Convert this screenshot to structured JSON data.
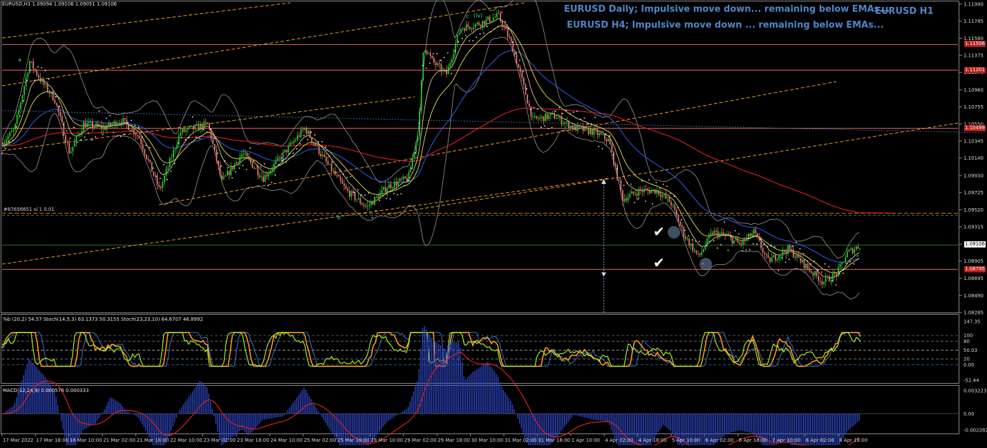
{
  "header": {
    "symbol_info": "EURUSD,H1  1.09094 1.09106 1.09051 1.09106",
    "label_h1": "EURUSD H1",
    "note_daily": "EURUSD Daily; Impulsive move down... remaining below EMAs...",
    "note_h4": "EURUSD H4; Impulsive move down ... remaining below EMAs..."
  },
  "colors": {
    "background": "#000000",
    "bull_candle": "#2cc82c",
    "bear_candle": "#e07a6a",
    "note_text": "#4f86c8",
    "level_line": "#e06060",
    "ema_long": "#d21f1f",
    "ema_mid": "#2f4fd0",
    "ema_short": "#d9d24a",
    "fib_dashed": "#f0a020",
    "psar": "#ffffff",
    "stoch_fast": "#a8f020",
    "stoch_slow": "#ff9a1a",
    "macd_hist": "#3048c8",
    "macd_signal": "#e02020"
  },
  "price_axis": {
    "ticks": [
      "1.11990",
      "1.11785",
      "1.11580",
      "1.11375",
      "1.11170",
      "1.10960",
      "1.10755",
      "1.10550",
      "1.10345",
      "1.10140",
      "1.09930",
      "1.09725",
      "1.09520",
      "1.09315",
      "1.09106",
      "1.08905",
      "1.08695",
      "1.08490",
      "1.08285"
    ],
    "tags": [
      {
        "label": "1.11506",
        "style": "red"
      },
      {
        "label": "1.11201",
        "style": "red"
      },
      {
        "label": "1.10499",
        "style": "red"
      },
      {
        "label": "1.09106",
        "style": "white"
      },
      {
        "label": "1.08795",
        "style": "red"
      }
    ]
  },
  "fib_label": "#87656651 sl 1 0.01",
  "wave_labels": [
    "a",
    "b",
    "c",
    "(iv)"
  ],
  "time_axis": {
    "ticks": [
      "17 Mar 2022",
      "17 Mar 18:00",
      "18 Mar 10:00",
      "21 Mar 02:00",
      "21 Mar 18:00",
      "22 Mar 10:00",
      "23 Mar 02:00",
      "23 Mar 18:00",
      "24 Mar 10:00",
      "25 Mar 02:00",
      "25 Mar 18:00",
      "28 Mar 10:00",
      "29 Mar 02:00",
      "29 Mar 18:00",
      "30 Mar 10:00",
      "31 Mar 02:00",
      "31 Mar 18:00",
      "1 Apr 10:00",
      "4 Apr 02:00",
      "4 Apr 18:00",
      "5 Apr 10:00",
      "6 Apr 02:00",
      "6 Apr 18:00",
      "7 Apr 10:00",
      "8 Apr 02:00",
      "8 Apr 18:00"
    ]
  },
  "oscillator": {
    "label": "%b (20,2) 54.57   Stoch(14,5,3) 63.1373 50.3155   Stoch(23,23,10) 64.6707 46.8992",
    "ticks": [
      "147.35",
      "100",
      "80",
      "50.03",
      "20",
      "0.00",
      "-52.44"
    ]
  },
  "macd": {
    "label": "MACD(12,24,9) 0.000576 0.000333",
    "ticks": [
      "0.003223",
      "0.00",
      "-0.002282"
    ]
  }
}
